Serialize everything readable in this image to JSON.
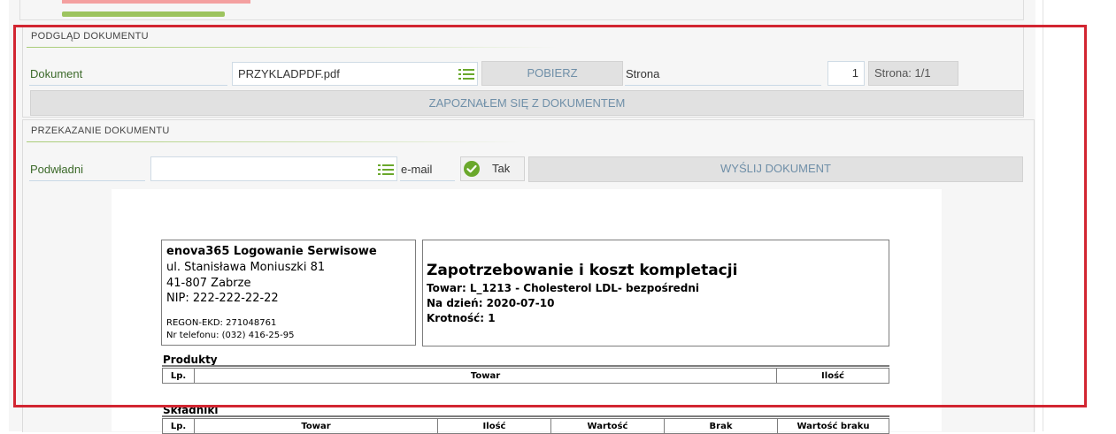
{
  "preview": {
    "section_title": "PODGLĄD DOKUMENTU",
    "document_label": "Dokument",
    "document_value": "PRZYKLADPDF.pdf",
    "download_button": "POBIERZ",
    "page_label": "Strona",
    "page_value": "1",
    "page_info": "Strona: 1/1",
    "acknowledge_button": "ZAPOZNAŁEM SIĘ Z DOKUMENTEM"
  },
  "transfer": {
    "section_title": "PRZEKAZANIE DOKUMENTU",
    "subordinates_label": "Podwładni",
    "subordinates_value": "",
    "email_label": "e-mail",
    "email_checkbox_label": "Tak",
    "email_checked": true,
    "send_button": "WYŚLIJ DOKUMENT"
  },
  "icons": {
    "list": "list-icon",
    "check": "check-circle-icon"
  },
  "colors": {
    "accent_green": "#9dc45f",
    "check_green": "#6aa82c",
    "highlight_red": "#d22531",
    "label_green": "#3c6a2a",
    "button_text": "#6f8fa8"
  },
  "pdf": {
    "company_name": "enova365 Logowanie Serwisowe",
    "company_street": "ul. Stanisława Moniuszki 81",
    "company_city": "41-807 Zabrze",
    "company_nip": "NIP: 222-222-22-22",
    "company_regon": "REGON-EKD: 271048761",
    "company_phone": "Nr telefonu: (032) 416-25-95",
    "doc_title": "Zapotrzebowanie i koszt kompletacji",
    "doc_item": "Towar: L_1213 - Cholesterol LDL- bezpośredni",
    "doc_date": "Na dzień: 2020-07-10",
    "doc_multiplicity": "Krotność: 1",
    "products_heading": "Produkty",
    "products_columns": [
      "Lp.",
      "Towar",
      "Ilość"
    ],
    "components_heading": "Składniki",
    "components_columns": [
      "Lp.",
      "Towar",
      "Ilość",
      "Wartość",
      "Brak",
      "Wartość braku"
    ]
  }
}
